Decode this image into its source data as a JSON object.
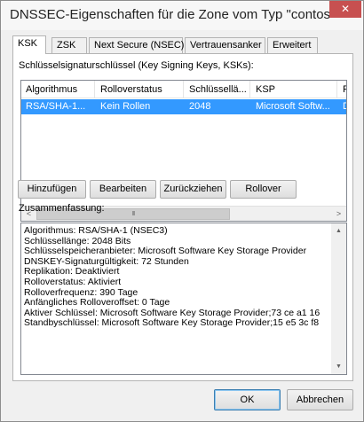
{
  "window": {
    "title": "DNSSEC-Eigenschaften für die Zone vom Typ \"contos",
    "close_glyph": "✕"
  },
  "tabs": [
    {
      "label": "KSK",
      "active": true
    },
    {
      "label": "ZSK",
      "active": false
    },
    {
      "label": "Next Secure (NSEC)",
      "active": false
    },
    {
      "label": "Vertrauensanker",
      "active": false
    },
    {
      "label": "Erweitert",
      "active": false
    }
  ],
  "ksk": {
    "list_label": "Schlüsselsignaturschlüssel (Key Signing Keys, KSKs):",
    "columns": [
      "Algorithmus",
      "Rolloverstatus",
      "Schlüssellä...",
      "KSP",
      "Re"
    ],
    "rows": [
      [
        "RSA/SHA-1...",
        "Kein Rollen",
        "2048",
        "Microsoft Softw...",
        "De"
      ]
    ],
    "buttons": {
      "add": "Hinzufügen",
      "edit": "Bearbeiten",
      "retract": "Zurückziehen",
      "rollover": "Rollover"
    },
    "summary_label": "Zusammenfassung:",
    "summary_lines": [
      "Algorithmus: RSA/SHA-1 (NSEC3)",
      "Schlüssellänge: 2048 Bits",
      "Schlüsselspeicheranbieter: Microsoft Software Key Storage Provider",
      "DNSKEY-Signaturgültigkeit: 72 Stunden",
      "Replikation: Deaktiviert",
      "Rolloverstatus: Aktiviert",
      "Rolloverfrequenz: 390 Tage",
      "Anfängliches Rolloveroffset: 0 Tage",
      "Aktiver Schlüssel: Microsoft Software Key Storage Provider;73 ce a1 16",
      "Standbyschlüssel: Microsoft Software Key Storage Provider;15 e5 3c f8"
    ]
  },
  "scroll": {
    "left_arrow": "<",
    "right_arrow": ">",
    "up_arrow": "▲",
    "down_arrow": "▼",
    "grip": "III"
  },
  "footer": {
    "ok": "OK",
    "cancel": "Abbrechen"
  }
}
